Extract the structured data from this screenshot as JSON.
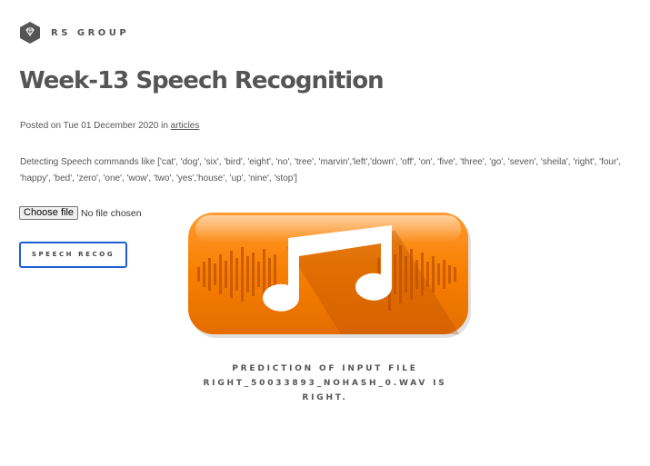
{
  "brand": {
    "name": "RS GROUP",
    "icon": "diamond-hexagon-icon"
  },
  "article": {
    "title": "Week-13 Speech Recognition",
    "posted_prefix": "Posted on Tue 01 December 2020 in ",
    "category_link": "articles",
    "description": "Detecting Speech commands like ['cat', 'dog', 'six', 'bird', 'eight', 'no', 'tree', 'marvin','left','down', 'off', 'on', 'five', 'three', 'go', 'seven', 'sheila', 'right', 'four', 'happy', 'bed', 'zero', 'one', 'wow', 'two', 'yes','house', 'up', 'nine', 'stop']"
  },
  "upload": {
    "button_label": "Choose file",
    "status": "No file chosen"
  },
  "speech_button": {
    "label": "SPEECH RECOG"
  },
  "media": {
    "icon": "music-note-icon",
    "accent": "#f77f00"
  },
  "prediction": {
    "text": "PREDICTION OF INPUT FILE\nRIGHT_50033893_NOHASH_0.WAV IS\nRIGHT."
  },
  "colors": {
    "text": "#555555",
    "button_border": "#1f5ed3",
    "icon_orange": "#f77f00"
  }
}
